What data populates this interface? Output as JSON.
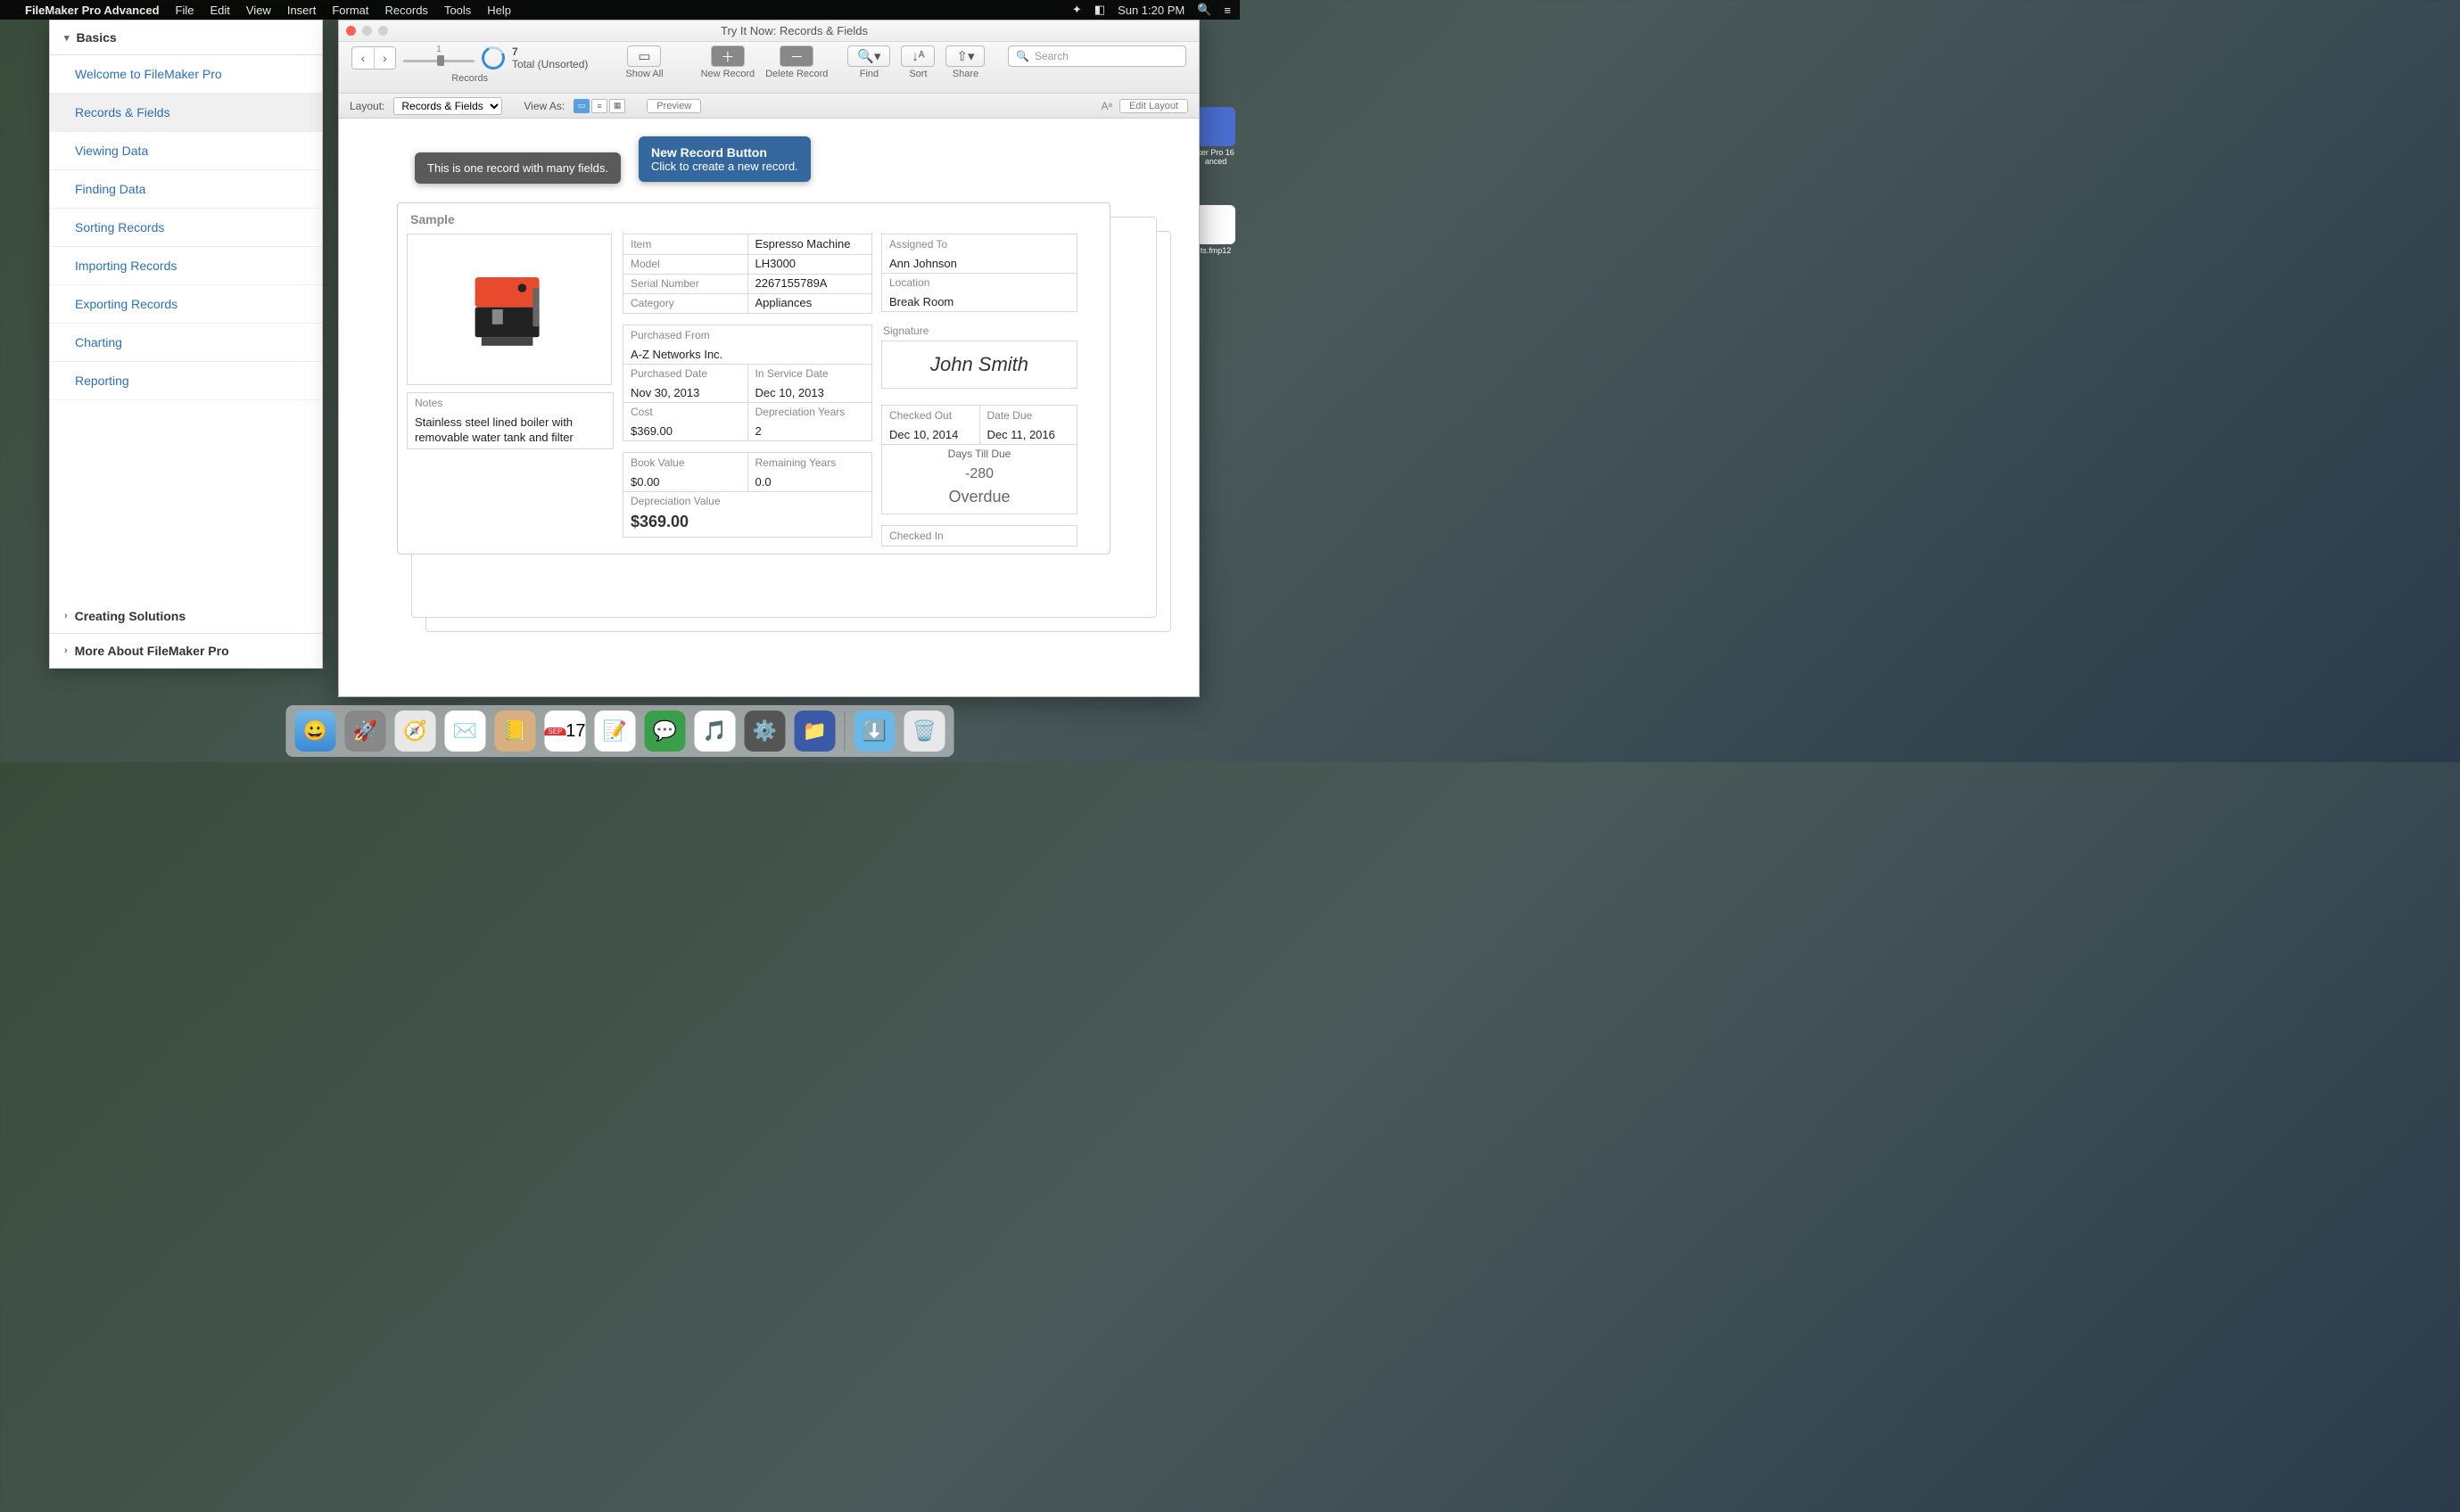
{
  "menubar": {
    "app": "FileMaker Pro Advanced",
    "items": [
      "File",
      "Edit",
      "View",
      "Insert",
      "Format",
      "Records",
      "Tools",
      "Help"
    ],
    "clock": "Sun 1:20 PM"
  },
  "help": {
    "sections": [
      {
        "title": "Basics",
        "items": [
          "Welcome to FileMaker Pro",
          "Records & Fields",
          "Viewing Data",
          "Finding Data",
          "Sorting Records",
          "Importing Records",
          "Exporting Records",
          "Charting",
          "Reporting"
        ],
        "selected": 1
      },
      {
        "title": "Creating Solutions"
      },
      {
        "title": "More About FileMaker Pro"
      }
    ]
  },
  "window": {
    "title": "Try It Now: Records & Fields"
  },
  "toolbar": {
    "record_current": "1",
    "record_total": "7",
    "record_status": "Total (Unsorted)",
    "labels": {
      "records": "Records",
      "showall": "Show All",
      "newrec": "New Record",
      "delrec": "Delete Record",
      "find": "Find",
      "sort": "Sort",
      "share": "Share"
    },
    "search_placeholder": "Search"
  },
  "subbar": {
    "layout_label": "Layout:",
    "layout_value": "Records & Fields",
    "viewas": "View As:",
    "preview": "Preview",
    "editlayout": "Edit Layout"
  },
  "callouts": {
    "c1": "This is one record with many fields.",
    "c2_title": "New Record Button",
    "c2_body": "Click to create a new record."
  },
  "record": {
    "heading": "Sample",
    "item_l": "Item",
    "item": "Espresso Machine",
    "model_l": "Model",
    "model": "LH3000",
    "serial_l": "Serial Number",
    "serial": "2267155789A",
    "category_l": "Category",
    "category": "Appliances",
    "notes_l": "Notes",
    "notes": "Stainless steel lined boiler with removable water tank and filter",
    "pfrom_l": "Purchased From",
    "pfrom": "A-Z Networks Inc.",
    "pdate_l": "Purchased Date",
    "pdate": "Nov 30, 2013",
    "svcdate_l": "In Service Date",
    "svcdate": "Dec 10, 2013",
    "cost_l": "Cost",
    "cost": "$369.00",
    "depy_l": "Depreciation Years",
    "depy": "2",
    "book_l": "Book Value",
    "book": "$0.00",
    "remy_l": "Remaining Years",
    "remy": "0.0",
    "depv_l": "Depreciation Value",
    "depv": "$369.00",
    "assigned_l": "Assigned To",
    "assigned": "Ann Johnson",
    "location_l": "Location",
    "location": "Break Room",
    "sig_l": "Signature",
    "sig": "John Smith",
    "cout_l": "Checked Out",
    "cout": "Dec 10, 2014",
    "due_l": "Date Due",
    "due": "Dec 11, 2016",
    "days_l": "Days Till Due",
    "days": "-280",
    "overdue": "Overdue",
    "cin_l": "Checked In"
  },
  "desktop": {
    "icon1": "ker Pro 16\nanced",
    "icon2": "ts.fmp12"
  },
  "dock": [
    "finder",
    "launchpad",
    "safari",
    "mail",
    "contacts",
    "calendar",
    "notes",
    "messages",
    "itunes",
    "settings",
    "filemaker",
    "downloads",
    "trash"
  ]
}
